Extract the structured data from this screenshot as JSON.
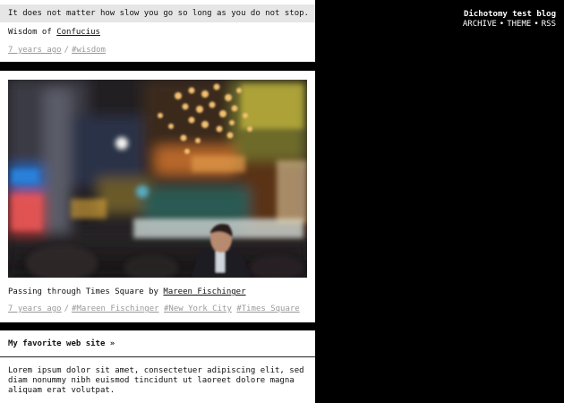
{
  "blog": {
    "title": "Dichotomy test blog",
    "nav": {
      "archive": "ARCHIVE",
      "theme": "THEME",
      "rss": "RSS",
      "separator": "•"
    }
  },
  "posts": {
    "quote": {
      "text": "It does not matter how slow you go so long as you do not stop.",
      "source_prefix": "Wisdom of",
      "source_link": "Confucius",
      "time_ago": "7 years ago",
      "separator": "/",
      "tags": [
        "#wisdom"
      ]
    },
    "photo": {
      "caption_prefix": "Passing through Times Square by",
      "caption_link": "Mareen Fischinger",
      "time_ago": "7 years ago",
      "separator": "/",
      "tags": [
        "#Mareen Fischinger",
        "#New York City",
        "#Times Square"
      ]
    },
    "link": {
      "title": "My favorite web site »",
      "body": "Lorem ipsum dolor sit amet, consectetuer adipiscing elit, sed diam nonummy nibh euismod tincidunt ut laoreet dolore magna aliquam erat volutpat."
    }
  },
  "colors": {
    "background": "#000000",
    "post_background": "#ffffff",
    "quote_band": "#e6e6e6",
    "meta_text": "#999999"
  },
  "icons": {
    "photo": "blurred-night-street-photo"
  }
}
